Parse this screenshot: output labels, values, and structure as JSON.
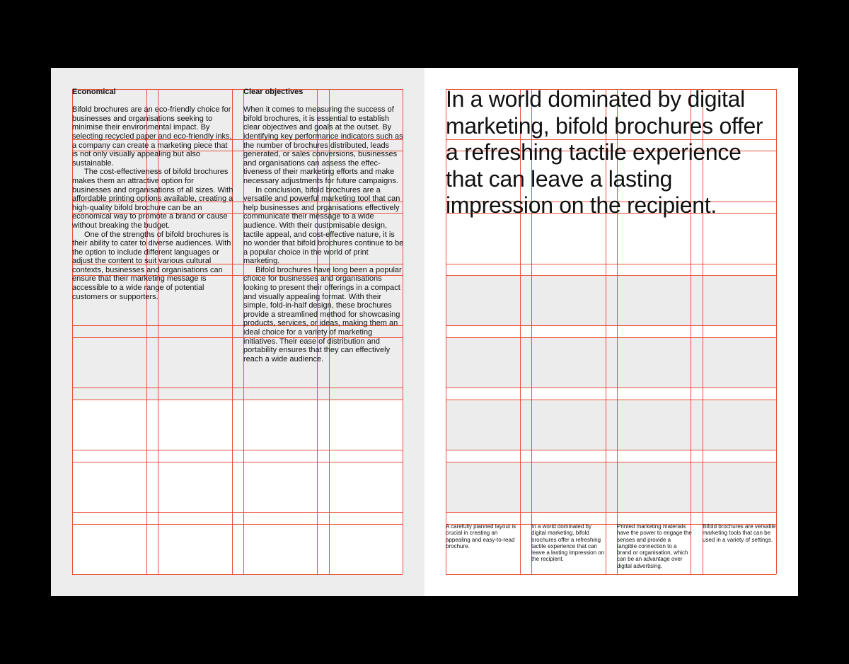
{
  "spread": {
    "left_page": {
      "columns": [
        {
          "heading": "Economical",
          "paragraphs": [
            "Bifold brochures are an eco-friendly choice for businesses and organisations seeking to minimise their environmental impact. By selecting recycled paper and eco-friendly inks, a company can create a marketing piece that is not only visually appealing but also sustainable.",
            "The cost-effectiveness of bifold brochures makes them an attractive option for businesses and organisations of all sizes. With affordable printing options available, creating a high-quality bifold brochure can be an economical way to promote a brand or cause without breaking the budget.",
            "One of the strengths of bifold brochures is their ability to cater to diverse audiences. With the option to include different languages or adjust the content to suit various cultural contexts, businesses and organisations can ensure that their marketing message is accessible to a wide range of potential customers or supporters."
          ]
        },
        {
          "heading": "Clear objectives",
          "paragraphs": [
            "When it comes to measuring the success of bifold brochures, it is essential to establish clear objectives and goals at the outset. By identifying key performance indicators such as the number of brochures distributed, leads generated, or sales conversions, businesses and organisations can assess the effec­tiveness of their marketing efforts and make necessary adjustments for future campaigns.",
            "In conclusion, bifold brochures are a versatile and powerful marketing tool that can help businesses and organisations effec­tively communicate their message to a wide audience. With their customisable design, tactile appeal, and cost-effective nature, it is no wonder that bifold brochures continue to be a popular choice in the world of print marketing.",
            "Bifold brochures have long been a popular choice for businesses and organi­sations looking to present their offerings in a compact and visually appealing format. With their simple, fold-in-half design, these brochures provide a streamlined method for showcasing products, services, or ideas, making them an ideal choice for a variety of marketing initiatives. Their ease of distri­bution and portability ensures that they can effectively reach a wide audience."
          ]
        }
      ]
    },
    "right_page": {
      "headline": "In a world dominated by digital marketing, bifold brochures offer a refreshing tactile experience that can leave a lasting impression on the recipient.",
      "captions": [
        "A carefully planned layout is crucial in creating an appealing and easy-to-read brochure.",
        "In a world dominated by digital marketing, bifold brochures offer a refreshing tactile experience that can leave a lasting impression on the recipient.",
        "Printed marketing materials have the power to engage the senses and provide a tangible connection to a brand or organisation, which can be an advantage over digital advertising.",
        "Bifold brochures are versatile marketing tools that can be used in a variety of settings."
      ]
    }
  },
  "colors": {
    "background": "#000000",
    "left_page": "#ededed",
    "right_page": "#ffffff",
    "grid_line": "#e8513a",
    "grid_fill_light": "#ffffff",
    "grid_fill_grey": "#ececec",
    "text": "#111111"
  }
}
